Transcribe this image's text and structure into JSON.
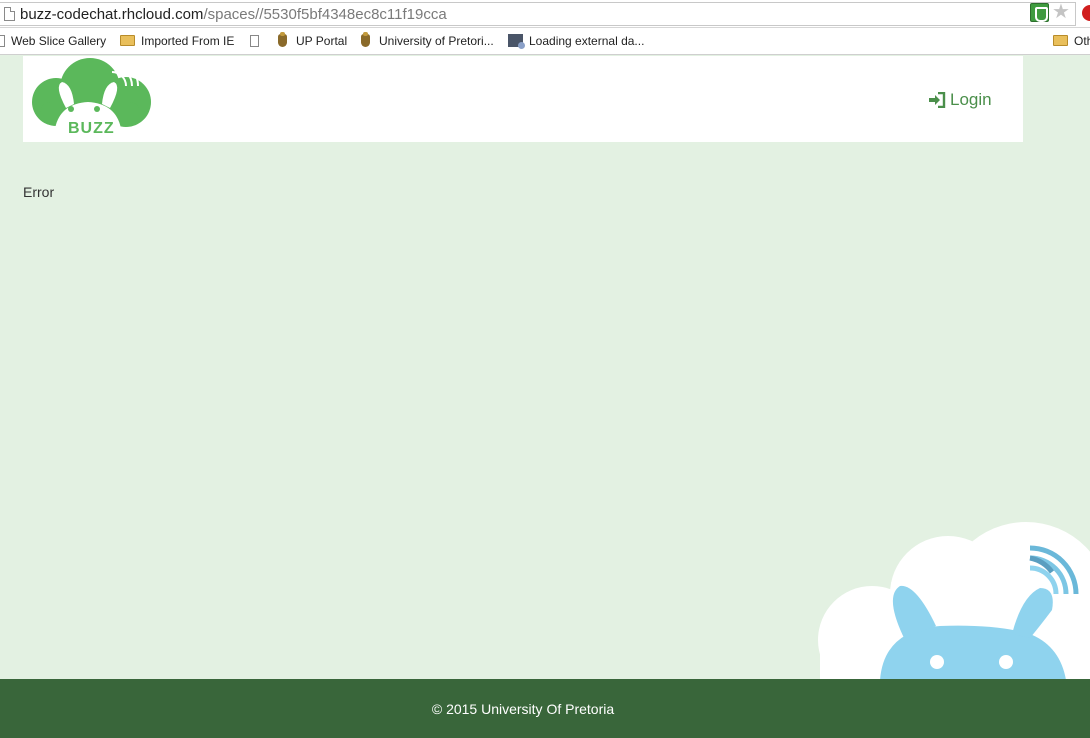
{
  "browser": {
    "url_host": "buzz-codechat.rhcloud.com",
    "url_path": "/spaces//5530f5bf4348ec8c11f19cca",
    "star_icon": "star-icon",
    "extension_icon": "shield-icon"
  },
  "bookmarks": [
    {
      "label": "Web Slice Gallery",
      "icon": "doc-icon"
    },
    {
      "label": "Imported From IE",
      "icon": "folder-icon"
    },
    {
      "label": "",
      "icon": "doc-icon"
    },
    {
      "label": "UP Portal",
      "icon": "crest-icon"
    },
    {
      "label": "University of Pretori...",
      "icon": "crest-icon"
    },
    {
      "label": "Loading external da...",
      "icon": "app-icon"
    },
    {
      "label": "Oth",
      "icon": "folder-icon"
    }
  ],
  "header": {
    "logo_text": "BUZZ",
    "login_label": "Login"
  },
  "content": {
    "message": "Error"
  },
  "footer": {
    "text": "© 2015 University Of Pretoria"
  },
  "colors": {
    "page_bg": "#e3f1e2",
    "footer_bg": "#39663a",
    "logo_green": "#5bb85b",
    "mascot_blue": "#8fd3ee"
  }
}
